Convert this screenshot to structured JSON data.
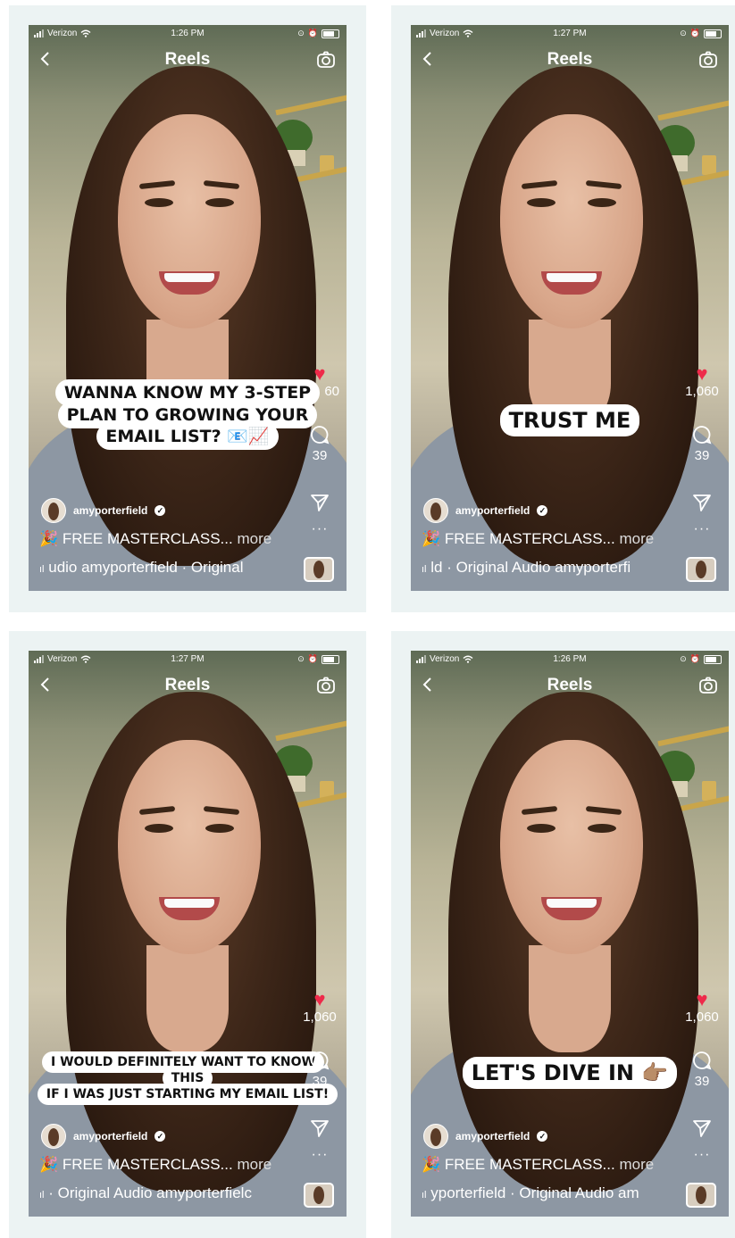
{
  "screens": [
    {
      "carrier": "Verizon",
      "time": "1:26 PM",
      "title": "Reels",
      "caption_lines": [
        "WANNA KNOW MY 3-STEP",
        "PLAN TO GROWING YOUR",
        "EMAIL LIST? 📧📈"
      ],
      "like_count": "1,060",
      "like_count_visible": "60",
      "comment_count": "39",
      "username": "amyporterfield",
      "description": "🎉 FREE MASTERCLASS...",
      "more_label": "more",
      "audio_text": "udio  amyporterfield · Original"
    },
    {
      "carrier": "Verizon",
      "time": "1:27 PM",
      "title": "Reels",
      "caption_lines": [
        "TRUST ME"
      ],
      "like_count": "1,060",
      "like_count_visible": "1,060",
      "comment_count": "39",
      "username": "amyporterfield",
      "description": "🎉 FREE MASTERCLASS...",
      "more_label": "more",
      "audio_text": "ld · Original Audio  amyporterfi"
    },
    {
      "carrier": "Verizon",
      "time": "1:27 PM",
      "title": "Reels",
      "caption_lines": [
        "I WOULD DEFINITELY WANT TO KNOW THIS",
        "IF I WAS JUST STARTING MY EMAIL LIST!"
      ],
      "like_count": "1,060",
      "like_count_visible": "1,060",
      "comment_count": "39",
      "username": "amyporterfield",
      "description": "🎉 FREE MASTERCLASS...",
      "more_label": "more",
      "audio_text": "· Original Audio  amyporterfielc"
    },
    {
      "carrier": "Verizon",
      "time": "1:26 PM",
      "title": "Reels",
      "caption_lines": [
        "LET'S DIVE IN 👉🏽"
      ],
      "like_count": "1,060",
      "like_count_visible": "1,060",
      "comment_count": "39",
      "username": "amyporterfield",
      "description": "🎉 FREE MASTERCLASS...",
      "more_label": "more",
      "audio_text": "yporterfield · Original Audio  am"
    }
  ],
  "icons": {
    "back": "chevron-left-icon",
    "camera": "camera-icon",
    "like": "heart-icon",
    "comment": "comment-icon",
    "share": "send-icon",
    "more": "more-icon",
    "audio": "audio-wave-icon",
    "verified": "verified-badge-icon"
  },
  "colors": {
    "heart": "#ee2a4a",
    "card_bg": "#ecf3f3"
  }
}
